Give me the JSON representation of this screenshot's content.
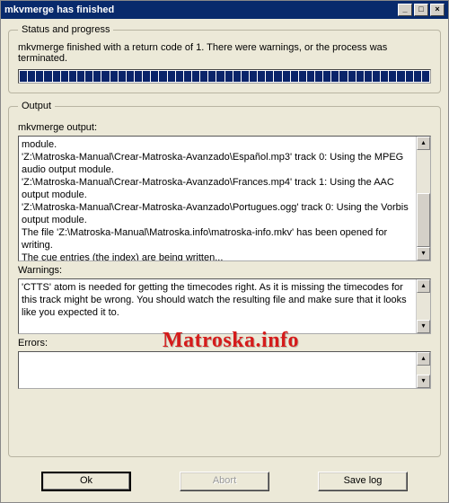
{
  "window": {
    "title": "mkvmerge has finished"
  },
  "status": {
    "legend": "Status and progress",
    "message": "mkvmerge finished with a return code of 1. There were warnings, or the process was terminated."
  },
  "output": {
    "legend": "Output",
    "output_label": "mkvmerge output:",
    "output_text": "module.\n'Z:\\Matroska-Manual\\Crear-Matroska-Avanzado\\Español.mp3' track 0: Using the MPEG audio output module.\n'Z:\\Matroska-Manual\\Crear-Matroska-Avanzado\\Frances.mp4' track 1: Using the AAC output module.\n'Z:\\Matroska-Manual\\Crear-Matroska-Avanzado\\Portugues.ogg' track 0: Using the Vorbis output module.\nThe file 'Z:\\Matroska-Manual\\Matroska.info\\matroska-info.mkv' has been opened for writing.\nThe cue entries (the index) are being written...",
    "warnings_label": "Warnings:",
    "warnings_text": "'CTTS' atom is needed for getting the timecodes right. As it is missing the timecodes for this track might be wrong. You should watch the resulting file and make sure that it looks like you expected it to.",
    "errors_label": "Errors:",
    "errors_text": ""
  },
  "buttons": {
    "ok": "Ok",
    "abort": "Abort",
    "save_log": "Save log"
  },
  "watermark": "Matroska.info"
}
